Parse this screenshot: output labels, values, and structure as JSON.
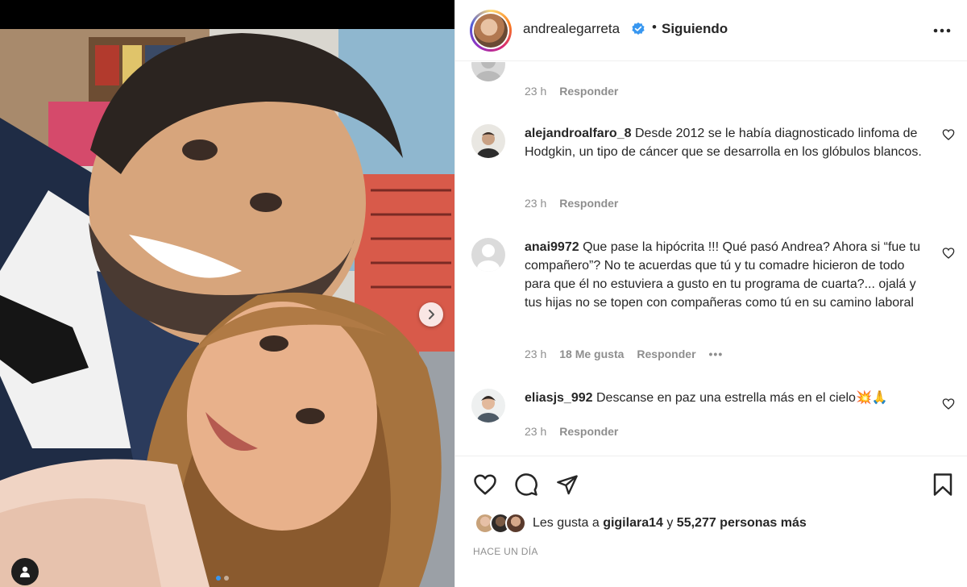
{
  "post": {
    "username": "andrealegarreta",
    "separator": "•",
    "follow_state": "Siguiendo",
    "likes": {
      "prefix": "Les gusta a",
      "first_liker": "gigilara14",
      "connector": "y",
      "count_text": "55,277 personas más"
    },
    "timestamp": "HACE UN DÍA"
  },
  "comments": [
    {
      "username": "",
      "text": "",
      "time": "23 h",
      "likes": "",
      "reply_label": "Responder"
    },
    {
      "username": "alejandroalfaro_8",
      "text": "Desde 2012 se le había diagnosticado linfoma de Hodgkin, un tipo de cáncer que se desarrolla en los glóbulos blancos.",
      "time": "23 h",
      "likes": "",
      "reply_label": "Responder"
    },
    {
      "username": "anai9972",
      "text": "Que pase la hipócrita !!! Qué pasó Andrea? Ahora si “fue tu compañero”? No te acuerdas que tú y tu comadre hicieron de todo para que él no estuviera a gusto en tu programa de cuarta?... ojalá y tus hijas no se topen con compañeras como tú en su camino laboral",
      "time": "23 h",
      "likes": "18 Me gusta",
      "reply_label": "Responder"
    },
    {
      "username": "eliasjs_992",
      "text": "Descanse en paz una estrella más en el cielo💥🙏",
      "time": "23 h",
      "likes": "",
      "reply_label": "Responder"
    }
  ],
  "icons": {
    "verified": "verified-badge-icon",
    "more": "more-options-icon",
    "like": "heart-icon",
    "comment": "comment-bubble-icon",
    "share": "paper-plane-icon",
    "save": "bookmark-icon",
    "next": "chevron-right-icon",
    "tag": "user-tag-icon"
  },
  "colors": {
    "verified": "#3897f0",
    "text": "#262626",
    "secondary": "#8e8e8e",
    "divider": "#efefef"
  },
  "carousel": {
    "current": 1,
    "total": 2
  }
}
